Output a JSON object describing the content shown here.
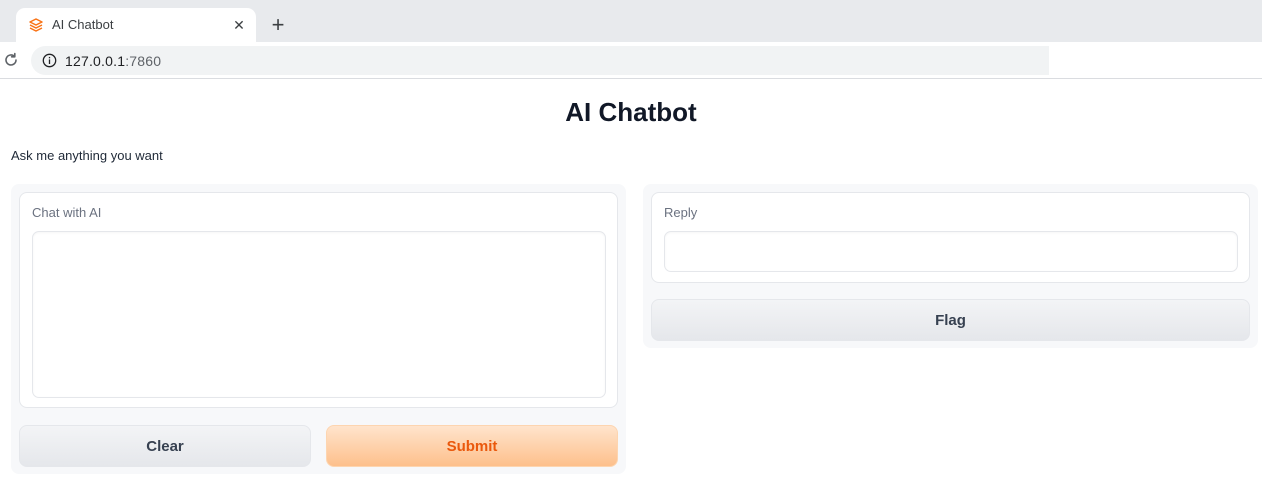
{
  "browser": {
    "tab_title": "AI Chatbot",
    "close_glyph": "✕",
    "new_tab_glyph": "+",
    "url_host": "127.0.0.1",
    "url_port": ":7860",
    "icons": {
      "favicon": "gradio-logo-icon",
      "reload": "reload-icon",
      "site_info": "info-icon"
    }
  },
  "page": {
    "title": "AI Chatbot",
    "description": "Ask me anything you want"
  },
  "input_panel": {
    "label": "Chat with AI",
    "value": "",
    "clear_label": "Clear",
    "submit_label": "Submit"
  },
  "output_panel": {
    "label": "Reply",
    "value": "",
    "flag_label": "Flag"
  },
  "colors": {
    "accent": "#ea580c",
    "primary_button": "#fdc08c",
    "secondary_button": "#e5e7eb",
    "panel_bg": "#f7f8fa"
  }
}
